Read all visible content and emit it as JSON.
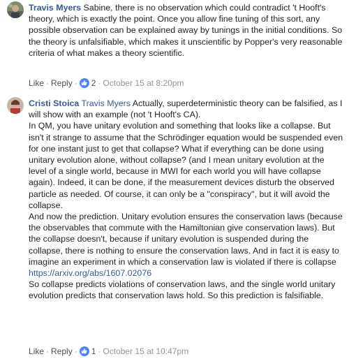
{
  "comments": [
    {
      "author": "Travis Myers",
      "mention": "",
      "text": " Sabine, there is no observation which could contradict 't Hooft's theory, which is exactly the point. Once you allow fine tuning of this sort, any possible observation can be explained away by tunings in the initial conditions. So the theory is unfalsifiable, which makes it unscientific by Popper's very reasonable criteria of what makes a theory scientific.",
      "actions": {
        "like": "Like",
        "reply": "Reply",
        "reactions": "2",
        "timestamp": "October 15 at 8:20pm"
      }
    },
    {
      "author": "Cristi Stoica",
      "mention": "Travis Myers",
      "text_before_link": " Actually, superdeterministic theory can be falsified, as I will show with an example (not 't Hooft's CA).\nIn QM, you have unitary evolution and something that looks like a collapse. But isn't it strange to assume that the Schrödinger equation would be suspended even for one instant just to get that collapse? What if everything can be done using unitary evolution alone, without collapse? (and I mean unitary evolution at the level of a single world, because in MWI for each world you will have collapse again). Indeed, it can be done, if the measurement devices disturb the observed particle as needed. Of course, it can only be a \"conspiracy\", but it will avoid the collapse.\nAnd now the prediction. Unitary evolution ensures the conservation laws (because the observables that commute with the Hamiltonian give conservation laws). But the collapse doesn't, because if unitary evolution is suspended during the collapse, there is nothing to ensure the conservation laws. And in fact it is easy to imagine an experiment in which a conservation law is violated if there is collapse\n",
      "link": "https://arxiv.org/abs/1607.02076",
      "text_after_link": "\nSo collapse predicts violations of conservation laws, and the single world unitary evolution predicts that conservation laws hold. So this prediction is falsifiable.",
      "actions": {
        "like": "Like",
        "reply": "Reply",
        "reactions": "1",
        "timestamp": "October 15 at 10:47pm"
      }
    }
  ],
  "colors": {
    "name": "#385898",
    "meta": "#90949c",
    "like_badge": "#4a86f7"
  },
  "icons": {
    "reaction": "thumbs-up-icon",
    "separator": "·"
  }
}
